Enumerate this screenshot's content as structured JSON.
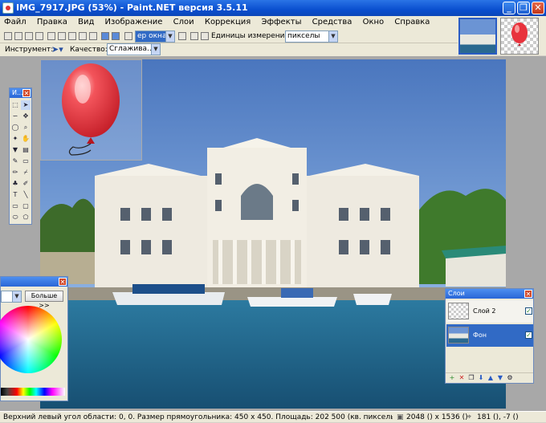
{
  "window": {
    "title": "IMG_7917.JPG (53%) - Paint.NET версия 3.5.11",
    "minimize_glyph": "_",
    "restore_glyph": "❐",
    "close_glyph": "✕"
  },
  "menu": [
    "Файл",
    "Правка",
    "Вид",
    "Изображение",
    "Слои",
    "Коррекция",
    "Эффекты",
    "Средства",
    "Окно",
    "Справка"
  ],
  "toolbar1": {
    "zoom_value": "ер окна",
    "units_label": "Единицы измерения:",
    "units_value": "пикселы"
  },
  "toolbar2": {
    "tool_label": "Инструмент:",
    "quality_label": "Качество:",
    "quality_value": "Сглажива..."
  },
  "tools_panel": {
    "title": "И...",
    "close_glyph": "✕"
  },
  "colors_panel": {
    "more_button": "Больше >>",
    "close_glyph": "✕"
  },
  "layers_panel": {
    "title": "Слои",
    "close_glyph": "✕",
    "layers": [
      {
        "name": "Слой 2",
        "visible": true,
        "selected": false
      },
      {
        "name": "Фон",
        "visible": true,
        "selected": true
      }
    ]
  },
  "status": {
    "text": "Верхний левый угол области: 0, 0. Размер прямоугольника: 450 x 450. Площадь: 202 500 (кв. пикселы)",
    "image_size": "2048 () x 1536 ()",
    "cursor_pos": "181 (), -7 ()"
  },
  "colors": {
    "titlebar": "#0a4fcf",
    "sky": "#5a86c8",
    "sea": "#1e5f86",
    "balloon": "#e8323c"
  }
}
